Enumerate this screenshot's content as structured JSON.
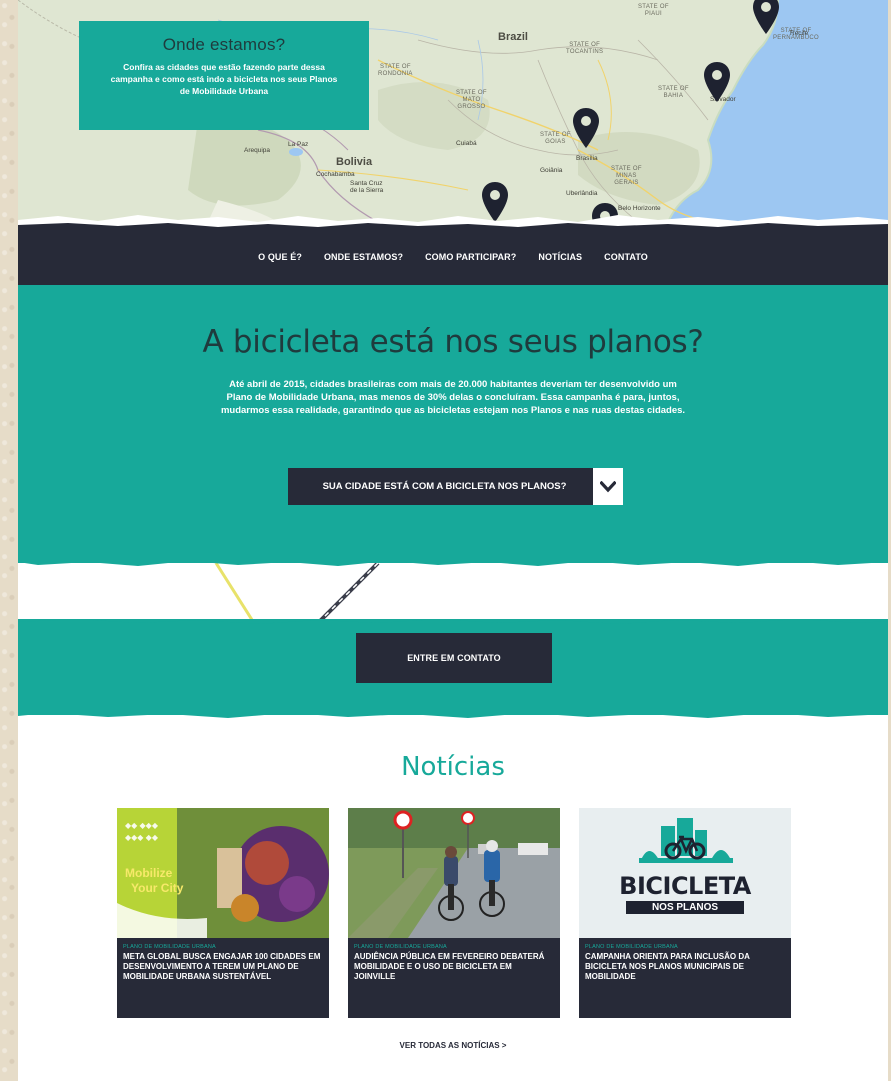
{
  "map": {
    "labels": {
      "brazil": "Brazil",
      "bolivia": "Bolivia",
      "state_piaui": "STATE OF\nPIAUI",
      "state_tocantins": "STATE OF\nTOCANTINS",
      "state_pernambuco": "STATE OF\nPERNAMBUCO",
      "state_bahia": "STATE OF\nBAHIA",
      "state_mato_grosso": "STATE OF\nMATO\nGROSSO",
      "state_goias": "STATE OF\nGOIAS",
      "state_minas": "STATE OF\nMINAS\nGERAIS",
      "state_rondonia": "STATE OF\nRONDONIA",
      "city_brasilia": "Brasília",
      "city_goiania": "Goiânia",
      "city_cuiaba": "Cuiabá",
      "city_uberlandia": "Uberlândia",
      "city_belo_horizonte": "Belo Horizonte",
      "city_recife": "Recife",
      "city_salvador": "Salvador",
      "city_santa_cruz": "Santa Cruz\nde la Sierra",
      "city_cochabamba": "Cochabamba",
      "city_la_paz": "La Paz",
      "city_arequipa": "Arequipa"
    },
    "info": {
      "title": "Onde estamos?",
      "text": "Confira as cidades que estão fazendo parte dessa campanha e como está indo a bicicleta nos seus Planos de Mobilidade Urbana"
    }
  },
  "nav": {
    "items": [
      "O QUE É?",
      "ONDE ESTAMOS?",
      "COMO PARTICIPAR?",
      "NOTÍCIAS",
      "CONTATO"
    ]
  },
  "hero": {
    "title": "A bicicleta está nos seus planos?",
    "text": "Até abril de 2015, cidades brasileiras com mais de 20.000 habitantes deveriam ter desenvolvido um Plano de Mobilidade Urbana, mas menos de 30% delas o concluíram. Essa campanha é para, juntos, mudarmos essa realidade, garantindo que as bicicletas estejam nos Planos e nas ruas destas cidades.",
    "select_label": "SUA CIDADE ESTÁ COM A BICICLETA NOS PLANOS?"
  },
  "contact": {
    "button_label": "ENTRE EM CONTATO"
  },
  "news": {
    "title": "Notícias",
    "cards": [
      {
        "tag": "PLANO DE MOBILIDADE URBANA",
        "title": "META GLOBAL BUSCA ENGAJAR 100 CIDADES EM DESENVOLVIMENTO A TEREM UM PLANO DE MOBILIDADE URBANA SUSTENTÁVEL",
        "image_text_1": "Mobilize",
        "image_text_2": "Your City"
      },
      {
        "tag": "PLANO DE MOBILIDADE URBANA",
        "title": "AUDIÊNCIA PÚBLICA EM FEVEREIRO DEBATERÁ MOBILIDADE E O USO DE BICICLETA EM JOINVILLE"
      },
      {
        "tag": "PLANO DE MOBILIDADE URBANA",
        "title": "CAMPANHA ORIENTA PARA INCLUSÃO DA BICICLETA NOS PLANOS MUNICIPAIS DE MOBILIDADE",
        "image_text_1": "BICICLETA",
        "image_text_2": "NOS PLANOS"
      }
    ],
    "see_all": "VER TODAS AS NOTÍCIAS >"
  },
  "colors": {
    "teal": "#17a99a",
    "dark_navy": "#272a38",
    "title_dark": "#1f3b3d",
    "paper_background": "#e6dcc8",
    "ocean": "#9dc7f2"
  },
  "icons": [
    "map-pin-icon",
    "chevron-down-icon",
    "bicycle-icon"
  ]
}
